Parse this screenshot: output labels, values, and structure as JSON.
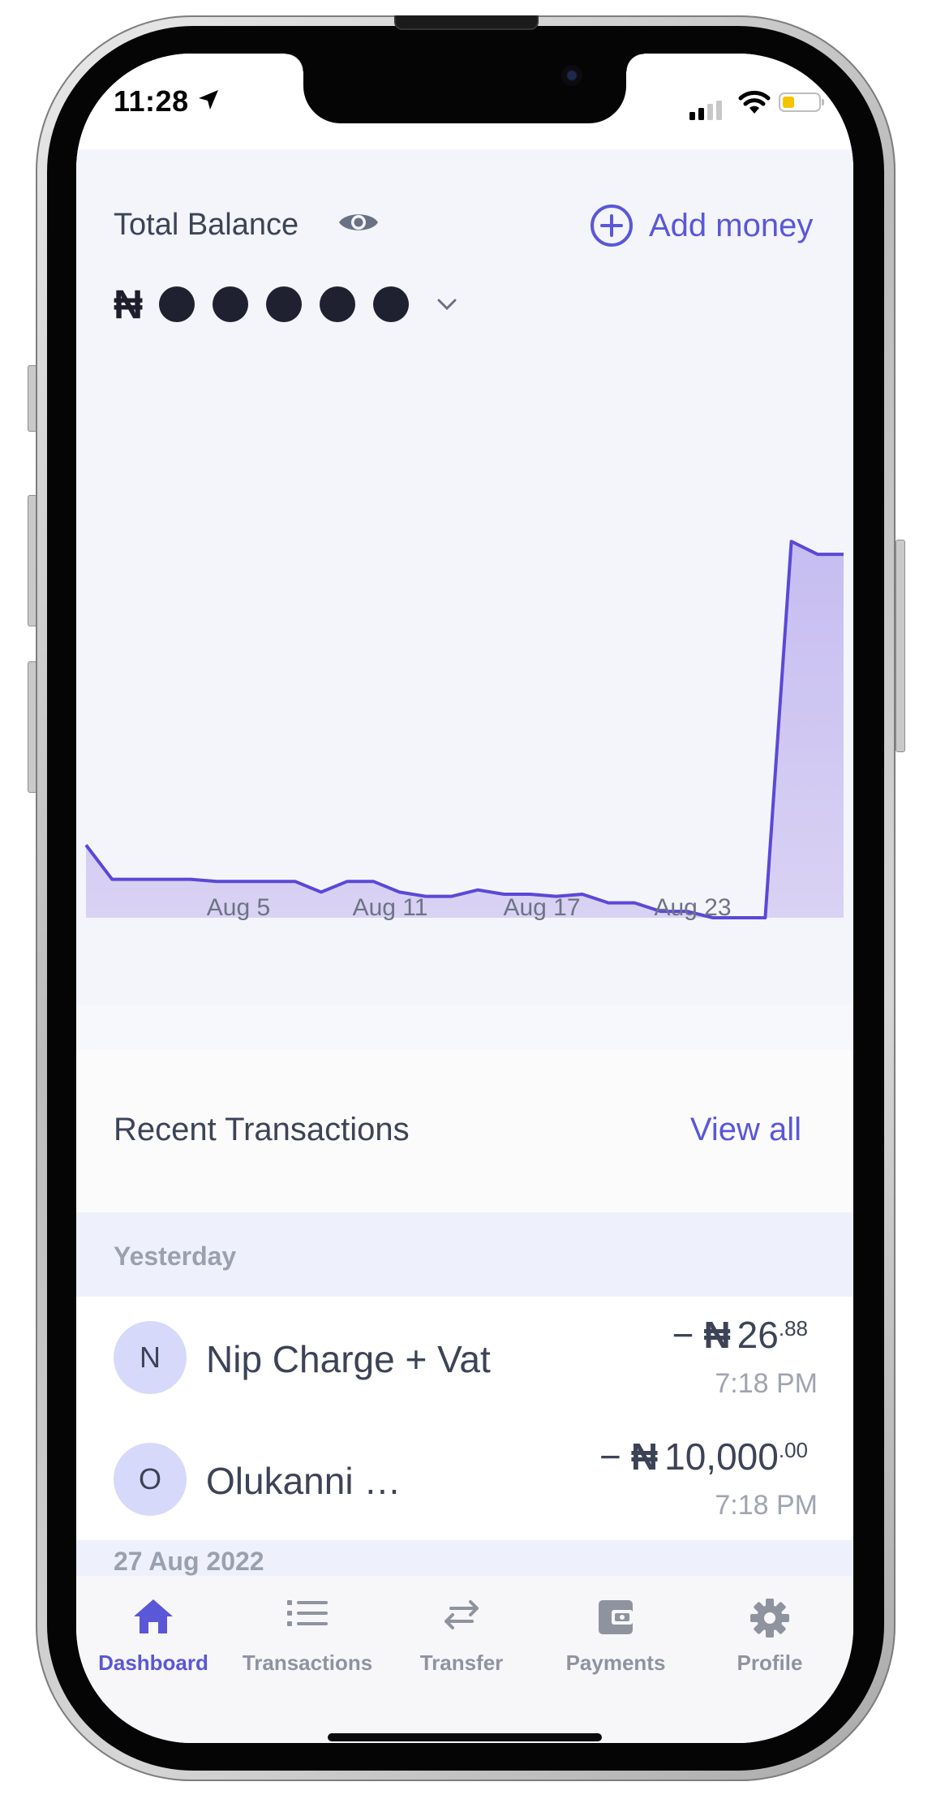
{
  "status_bar": {
    "time": "11:28"
  },
  "balance": {
    "label": "Total Balance",
    "add_money": "Add money",
    "currency": "₦"
  },
  "chart_data": {
    "type": "area",
    "x_ticks": [
      "Aug 5",
      "Aug 11",
      "Aug 17",
      "Aug 23"
    ],
    "values": [
      0.17,
      0.09,
      0.09,
      0.09,
      0.09,
      0.085,
      0.085,
      0.085,
      0.085,
      0.06,
      0.085,
      0.085,
      0.06,
      0.05,
      0.05,
      0.065,
      0.055,
      0.055,
      0.05,
      0.055,
      0.035,
      0.035,
      0.015,
      0.015,
      0,
      0,
      0,
      0.88,
      0.85,
      0.85
    ],
    "fill_color": "#c6bdf1",
    "line_color": "#5b48d8",
    "grid": false
  },
  "transactions": {
    "title": "Recent Transactions",
    "view_all": "View all",
    "groups": [
      {
        "label": "Yesterday",
        "items": [
          {
            "initial": "N",
            "name": "Nip Charge + Vat",
            "sign": "−",
            "currency": "₦",
            "amount": "26",
            "decimals": ".88",
            "time": "7:18 PM"
          },
          {
            "initial": "O",
            "name": "Olukanni …",
            "sign": "−",
            "currency": "₦",
            "amount": "10,000",
            "decimals": ".00",
            "time": "7:18 PM"
          }
        ]
      },
      {
        "label": "27 Aug 2022",
        "items": []
      }
    ]
  },
  "tabs": [
    {
      "label": "Dashboard",
      "icon": "home-icon",
      "active": true
    },
    {
      "label": "Transactions",
      "icon": "list-icon",
      "active": false
    },
    {
      "label": "Transfer",
      "icon": "transfer-arrows-icon",
      "active": false
    },
    {
      "label": "Payments",
      "icon": "wallet-icon",
      "active": false
    },
    {
      "label": "Profile",
      "icon": "gear-icon",
      "active": false
    }
  ],
  "colors": {
    "accent": "#5a57d8",
    "avatar_bg": "#d6d9fa",
    "text": "#3d4357",
    "muted": "#a0a4b0"
  }
}
